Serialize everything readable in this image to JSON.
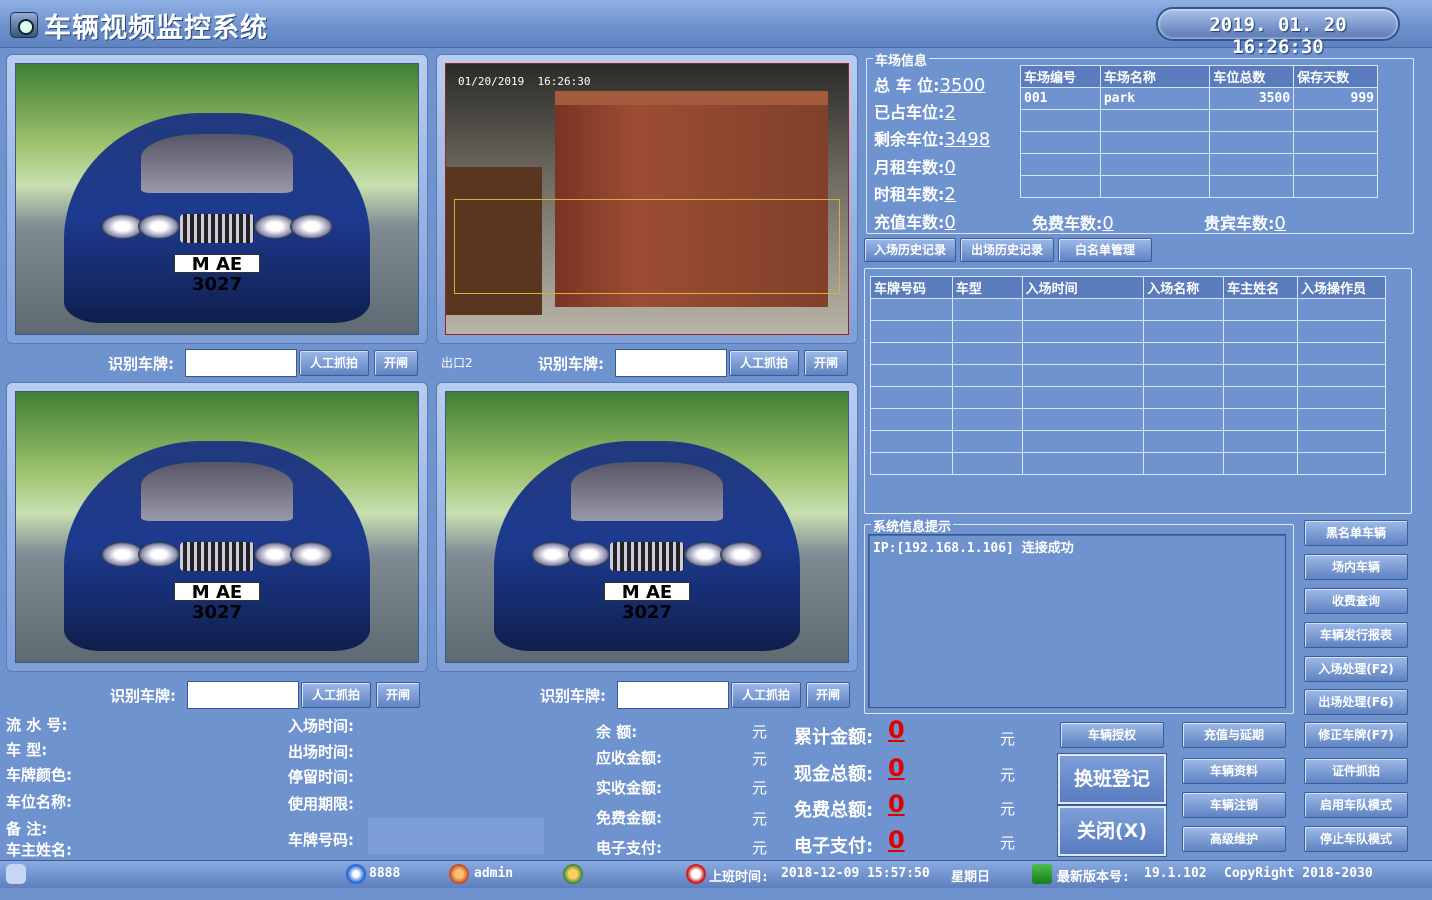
{
  "app": {
    "title": "车辆视频监控系统",
    "datetime": "2019. 01. 20  16:26:30"
  },
  "cameras": [
    {
      "plate_label": "识别车牌:",
      "plate_value": "",
      "capture_btn": "人工抓拍",
      "gate_btn": "开闸",
      "overlay_plate": "M AE 3027",
      "caption": ""
    },
    {
      "plate_label": "识别车牌:",
      "plate_value": "",
      "capture_btn": "人工抓拍",
      "gate_btn": "开闸",
      "osd": "01/20/2019  16:26:30",
      "caption": "出口2"
    },
    {
      "plate_label": "识别车牌:",
      "plate_value": "",
      "capture_btn": "人工抓拍",
      "gate_btn": "开闸",
      "overlay_plate": "M AE 3027",
      "caption": ""
    },
    {
      "plate_label": "识别车牌:",
      "plate_value": "",
      "capture_btn": "人工抓拍",
      "gate_btn": "开闸",
      "overlay_plate": "M AE 3027",
      "caption": ""
    }
  ],
  "lot_info": {
    "group_title": "车场信息",
    "total_label": "总 车 位:",
    "total": "3500",
    "occupied_label": "已占车位:",
    "occupied": "2",
    "free_label": "剩余车位:",
    "free": "3498",
    "monthly_label": "月租车数:",
    "monthly": "0",
    "hourly_label": "时租车数:",
    "hourly": "2",
    "prepaid_label": "充值车数:",
    "prepaid": "0",
    "freecar_label": "免费车数:",
    "freecar": "0",
    "vip_label": "贵宾车数:",
    "vip": "0",
    "table_headers": [
      "车场编号",
      "车场名称",
      "车位总数",
      "保存天数"
    ],
    "table_rows": [
      [
        "001",
        "park",
        "3500",
        "999"
      ]
    ]
  },
  "history_tabs": [
    "入场历史记录",
    "出场历史记录",
    "白名单管理"
  ],
  "entry_table": {
    "headers": [
      "车牌号码",
      "车型",
      "入场时间",
      "入场名称",
      "车主姓名",
      "入场操作员"
    ]
  },
  "sys_msg": {
    "title": "系统信息提示",
    "text": "IP:[192.168.1.106] 连接成功"
  },
  "right_buttons": [
    "黑名单车辆",
    "场内车辆",
    "收费查询",
    "车辆发行报表",
    "入场处理(F2)",
    "出场处理(F6)",
    "修正车牌(F7)",
    "证件抓拍",
    "启用车队模式",
    "停止车队模式"
  ],
  "mid_buttons": [
    "车辆授权",
    "充值与延期",
    "车辆资料",
    "车辆注销",
    "高级维护"
  ],
  "big_buttons": [
    "换班登记",
    "关闭(X)"
  ],
  "fields_left": [
    "流 水 号:",
    "车      型:",
    "车牌颜色:",
    "车位名称:",
    "备      注:",
    "车主姓名:"
  ],
  "fields_mid": [
    "入场时间:",
    "出场时间:",
    "停留时间:",
    "使用期限:",
    "车牌号码:"
  ],
  "fees": [
    {
      "label": "余      额:",
      "unit": "元"
    },
    {
      "label": "应收金额:",
      "unit": "元"
    },
    {
      "label": "实收金额:",
      "unit": "元"
    },
    {
      "label": "免费金额:",
      "unit": "元"
    },
    {
      "label": "电子支付:",
      "unit": "元"
    }
  ],
  "totals": [
    {
      "label": "累计金额:",
      "value": "0",
      "unit": "元"
    },
    {
      "label": "现金总额:",
      "value": "0",
      "unit": "元"
    },
    {
      "label": "免费总额:",
      "value": "0",
      "unit": "元"
    },
    {
      "label": "电子支付:",
      "value": "0",
      "unit": "元"
    }
  ],
  "status": {
    "code": "8888",
    "user": "admin",
    "shift_label": "上班时间:",
    "shift_time": "2018-12-09 15:57:50",
    "weekday": "星期日",
    "version_label": "最新版本号:",
    "version": "19.1.102",
    "copyright": "CopyRight 2018-2030"
  }
}
